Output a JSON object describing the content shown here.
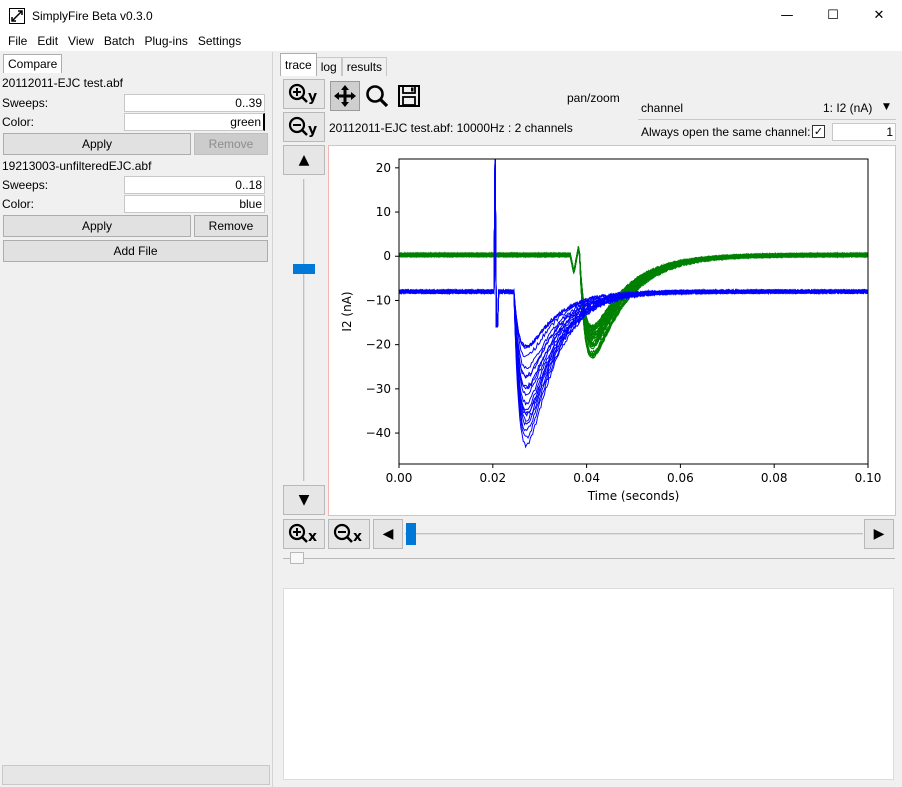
{
  "window": {
    "title": "SimplyFire Beta v0.3.0",
    "minimize": "—",
    "maximize": "☐",
    "close": "✕"
  },
  "menu": [
    "File",
    "Edit",
    "View",
    "Batch",
    "Plug-ins",
    "Settings"
  ],
  "left": {
    "tab": "Compare",
    "files": [
      {
        "name": "20112011-EJC test.abf",
        "sweeps_label": "Sweeps:",
        "sweeps": "0..39",
        "color_label": "Color:",
        "color": "green",
        "apply": "Apply",
        "remove": "Remove",
        "remove_disabled": true
      },
      {
        "name": "19213003-unfilteredEJC.abf",
        "sweeps_label": "Sweeps:",
        "sweeps": "0..18",
        "color_label": "Color:",
        "color": "blue",
        "apply": "Apply",
        "remove": "Remove",
        "remove_disabled": false
      }
    ],
    "add_file": "Add File"
  },
  "right": {
    "tabs": [
      "trace",
      "log",
      "results"
    ],
    "active_tab": "trace",
    "mode": "pan/zoom",
    "file_info": "20112011-EJC test.abf: 10000Hz : 2 channels",
    "channel_label": "channel",
    "channel_value": "1: I2 (nA)",
    "always_open_label": "Always open the same channel:",
    "always_open_checked": "✓",
    "channel_num": "1",
    "zoom_in_y": "⊕y",
    "zoom_out_y": "⊖y",
    "zoom_in_x": "⊕x",
    "zoom_out_x": "⊖x",
    "up_arrow": "▲",
    "down_arrow": "▼",
    "left_arrow": "◀",
    "right_arrow": "▶"
  },
  "chart_data": {
    "type": "line",
    "xlabel": "Time (seconds)",
    "ylabel": "I2 (nA)",
    "xlim": [
      0.0,
      0.1
    ],
    "ylim": [
      -47,
      22
    ],
    "xticks": [
      0.0,
      0.02,
      0.04,
      0.06,
      0.08,
      0.1
    ],
    "xtick_labels": [
      "0.00",
      "0.02",
      "0.04",
      "0.06",
      "0.08",
      "0.10"
    ],
    "yticks": [
      20,
      10,
      0,
      -10,
      -20,
      -30,
      -40
    ],
    "ytick_labels": [
      "20",
      "10",
      "0",
      "−10",
      "−20",
      "−30",
      "−40"
    ],
    "series": [
      {
        "color": "#008000",
        "sweeps": 40,
        "baseline": 0.3,
        "peak_time": 0.042,
        "peak_min": -23,
        "peak_max": -16,
        "artifact_time": 0.037
      },
      {
        "color": "#0000ff",
        "sweeps": 19,
        "baseline": -8.0,
        "peak_time": 0.029,
        "peak_min": -45,
        "peak_max": -20,
        "artifact_time": 0.0205
      }
    ]
  }
}
